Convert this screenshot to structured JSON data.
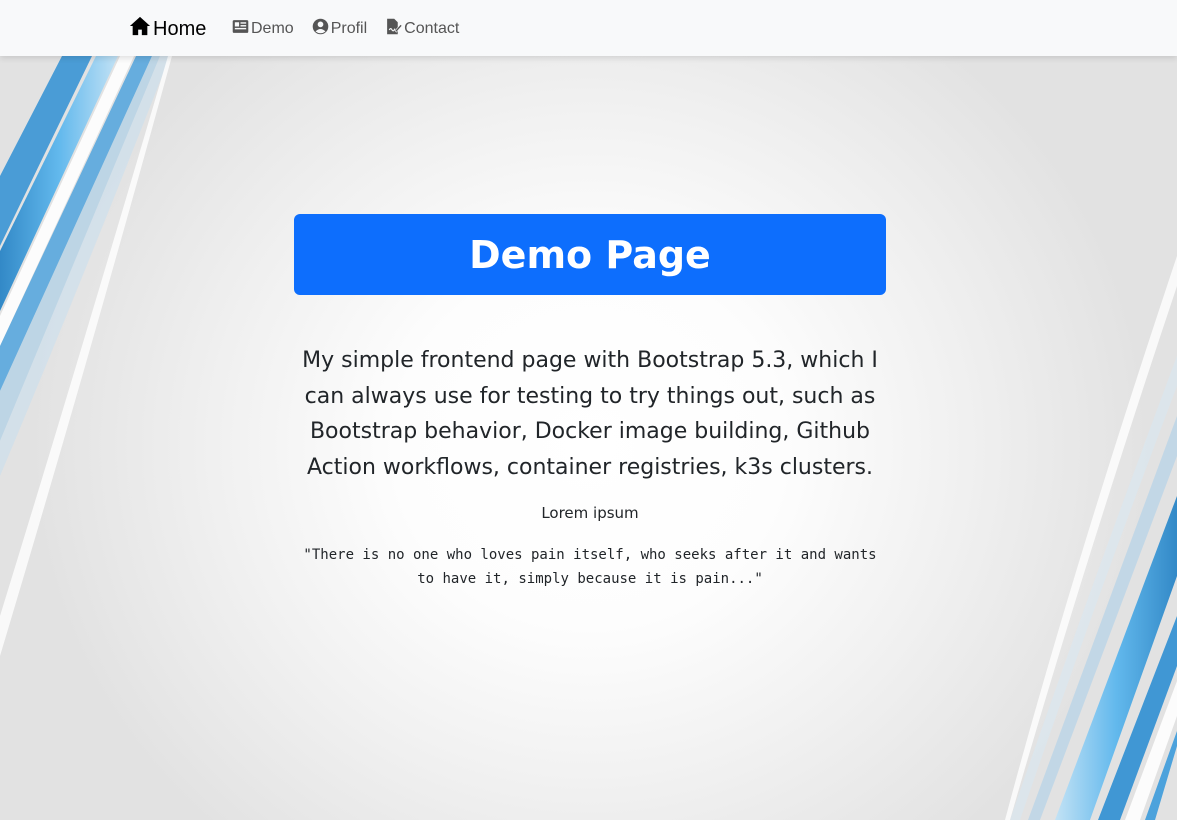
{
  "navbar": {
    "brand": {
      "label": "Home",
      "icon": "home-icon"
    },
    "links": [
      {
        "label": "Demo",
        "icon": "newspaper-icon"
      },
      {
        "label": "Profil",
        "icon": "user-circle-icon"
      },
      {
        "label": "Contact",
        "icon": "file-signature-icon"
      }
    ]
  },
  "main": {
    "title": "Demo Page",
    "description": "My simple frontend page with Bootstrap 5.3, which I can always use for testing to try things out, such as Bootstrap behavior, Docker image building, Github Action workflows, container registries, k3s clusters.",
    "subtitle": "Lorem ipsum",
    "quote": "\"There is no one who loves pain itself, who seeks after it and wants to have it, simply because it is pain...\""
  },
  "colors": {
    "primary": "#0d6efd",
    "navbar_bg": "#f8f9fa",
    "text": "#212529",
    "accent_blue": "#2a8fd6"
  }
}
